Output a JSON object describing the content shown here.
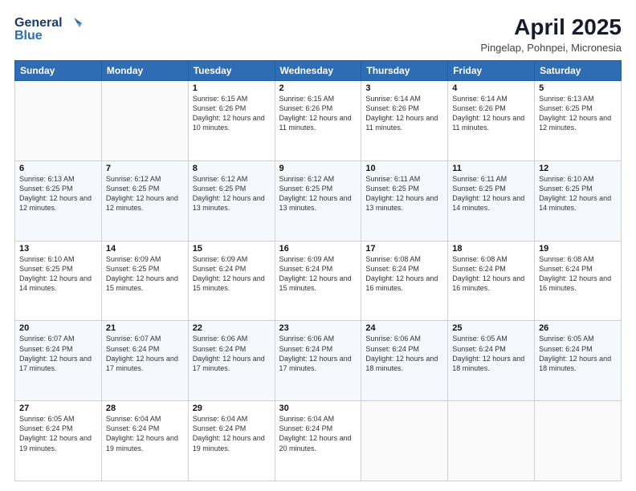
{
  "header": {
    "logo_line1": "General",
    "logo_line2": "Blue",
    "title": "April 2025",
    "subtitle": "Pingelap, Pohnpei, Micronesia"
  },
  "days_of_week": [
    "Sunday",
    "Monday",
    "Tuesday",
    "Wednesday",
    "Thursday",
    "Friday",
    "Saturday"
  ],
  "weeks": [
    [
      {
        "day": "",
        "info": ""
      },
      {
        "day": "",
        "info": ""
      },
      {
        "day": "1",
        "info": "Sunrise: 6:15 AM\nSunset: 6:26 PM\nDaylight: 12 hours and 10 minutes."
      },
      {
        "day": "2",
        "info": "Sunrise: 6:15 AM\nSunset: 6:26 PM\nDaylight: 12 hours and 11 minutes."
      },
      {
        "day": "3",
        "info": "Sunrise: 6:14 AM\nSunset: 6:26 PM\nDaylight: 12 hours and 11 minutes."
      },
      {
        "day": "4",
        "info": "Sunrise: 6:14 AM\nSunset: 6:26 PM\nDaylight: 12 hours and 11 minutes."
      },
      {
        "day": "5",
        "info": "Sunrise: 6:13 AM\nSunset: 6:25 PM\nDaylight: 12 hours and 12 minutes."
      }
    ],
    [
      {
        "day": "6",
        "info": "Sunrise: 6:13 AM\nSunset: 6:25 PM\nDaylight: 12 hours and 12 minutes."
      },
      {
        "day": "7",
        "info": "Sunrise: 6:12 AM\nSunset: 6:25 PM\nDaylight: 12 hours and 12 minutes."
      },
      {
        "day": "8",
        "info": "Sunrise: 6:12 AM\nSunset: 6:25 PM\nDaylight: 12 hours and 13 minutes."
      },
      {
        "day": "9",
        "info": "Sunrise: 6:12 AM\nSunset: 6:25 PM\nDaylight: 12 hours and 13 minutes."
      },
      {
        "day": "10",
        "info": "Sunrise: 6:11 AM\nSunset: 6:25 PM\nDaylight: 12 hours and 13 minutes."
      },
      {
        "day": "11",
        "info": "Sunrise: 6:11 AM\nSunset: 6:25 PM\nDaylight: 12 hours and 14 minutes."
      },
      {
        "day": "12",
        "info": "Sunrise: 6:10 AM\nSunset: 6:25 PM\nDaylight: 12 hours and 14 minutes."
      }
    ],
    [
      {
        "day": "13",
        "info": "Sunrise: 6:10 AM\nSunset: 6:25 PM\nDaylight: 12 hours and 14 minutes."
      },
      {
        "day": "14",
        "info": "Sunrise: 6:09 AM\nSunset: 6:25 PM\nDaylight: 12 hours and 15 minutes."
      },
      {
        "day": "15",
        "info": "Sunrise: 6:09 AM\nSunset: 6:24 PM\nDaylight: 12 hours and 15 minutes."
      },
      {
        "day": "16",
        "info": "Sunrise: 6:09 AM\nSunset: 6:24 PM\nDaylight: 12 hours and 15 minutes."
      },
      {
        "day": "17",
        "info": "Sunrise: 6:08 AM\nSunset: 6:24 PM\nDaylight: 12 hours and 16 minutes."
      },
      {
        "day": "18",
        "info": "Sunrise: 6:08 AM\nSunset: 6:24 PM\nDaylight: 12 hours and 16 minutes."
      },
      {
        "day": "19",
        "info": "Sunrise: 6:08 AM\nSunset: 6:24 PM\nDaylight: 12 hours and 16 minutes."
      }
    ],
    [
      {
        "day": "20",
        "info": "Sunrise: 6:07 AM\nSunset: 6:24 PM\nDaylight: 12 hours and 17 minutes."
      },
      {
        "day": "21",
        "info": "Sunrise: 6:07 AM\nSunset: 6:24 PM\nDaylight: 12 hours and 17 minutes."
      },
      {
        "day": "22",
        "info": "Sunrise: 6:06 AM\nSunset: 6:24 PM\nDaylight: 12 hours and 17 minutes."
      },
      {
        "day": "23",
        "info": "Sunrise: 6:06 AM\nSunset: 6:24 PM\nDaylight: 12 hours and 17 minutes."
      },
      {
        "day": "24",
        "info": "Sunrise: 6:06 AM\nSunset: 6:24 PM\nDaylight: 12 hours and 18 minutes."
      },
      {
        "day": "25",
        "info": "Sunrise: 6:05 AM\nSunset: 6:24 PM\nDaylight: 12 hours and 18 minutes."
      },
      {
        "day": "26",
        "info": "Sunrise: 6:05 AM\nSunset: 6:24 PM\nDaylight: 12 hours and 18 minutes."
      }
    ],
    [
      {
        "day": "27",
        "info": "Sunrise: 6:05 AM\nSunset: 6:24 PM\nDaylight: 12 hours and 19 minutes."
      },
      {
        "day": "28",
        "info": "Sunrise: 6:04 AM\nSunset: 6:24 PM\nDaylight: 12 hours and 19 minutes."
      },
      {
        "day": "29",
        "info": "Sunrise: 6:04 AM\nSunset: 6:24 PM\nDaylight: 12 hours and 19 minutes."
      },
      {
        "day": "30",
        "info": "Sunrise: 6:04 AM\nSunset: 6:24 PM\nDaylight: 12 hours and 20 minutes."
      },
      {
        "day": "",
        "info": ""
      },
      {
        "day": "",
        "info": ""
      },
      {
        "day": "",
        "info": ""
      }
    ]
  ]
}
